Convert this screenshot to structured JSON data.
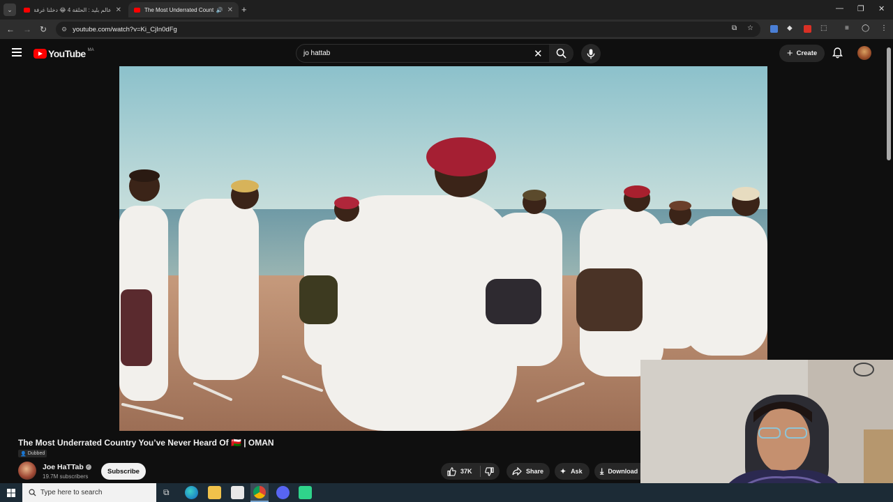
{
  "browser": {
    "tabs": [
      {
        "title": "عالم بليد : الحلقة 4 😂 دخلنا غرفة"
      },
      {
        "title": "The Most Underrated Count"
      }
    ],
    "url": "youtube.com/watch?v=Ki_CjIn0dFg"
  },
  "youtube": {
    "logo_text": "YouTube",
    "country_code": "MA",
    "search_query": "jo hattab",
    "create_label": "Create"
  },
  "video": {
    "title": "The Most Underrated Country You’ve Never Heard Of 🇴🇲 | OMAN",
    "dubbed_label": "Dubbed",
    "channel_name": "Joe HaTTab",
    "subscribers": "19.7M subscribers",
    "subscribe_label": "Subscribe",
    "likes": "37K",
    "share_label": "Share",
    "ask_label": "Ask",
    "download_label": "Download"
  },
  "taskbar": {
    "search_placeholder": "Type here to search"
  },
  "colors": {
    "accent": "#ff0000",
    "background": "#0f0f0f"
  }
}
